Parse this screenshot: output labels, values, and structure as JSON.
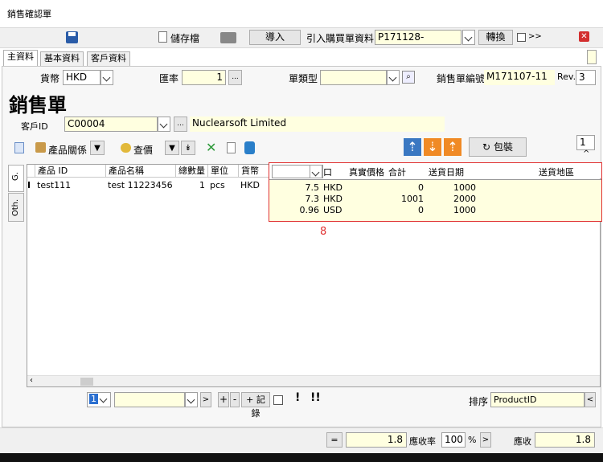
{
  "window": {
    "title": "銷售確認單"
  },
  "toolbar": {
    "save_label": "儲存檔",
    "import_label": "導入",
    "import_purchase_label": "引入購買單資料",
    "purchase_no": "P171128-",
    "convert_label": "轉換",
    "more_label": ">>"
  },
  "tabs": [
    "主資料",
    "基本資料",
    "客戶資料"
  ],
  "header": {
    "currency_label": "貨幣",
    "currency_value": "HKD",
    "rate_label": "匯率",
    "rate_value": "1",
    "ellipsis": "...",
    "doc_type_label": "單類型",
    "doc_type_value": "",
    "sales_no_label": "銷售單編號",
    "sales_no_value": "M171107-11",
    "rev_label": "Rev.",
    "rev_value": "3"
  },
  "form_title": "銷售單",
  "customer": {
    "label": "客戶ID",
    "id": "C00004",
    "name": "Nuclearsoft Limited"
  },
  "actions": {
    "product_relation_label": "產品關係",
    "query_price_label": "查價",
    "pack_label": "包裝",
    "page_value": "1",
    "up_arrow": "^"
  },
  "side_tabs": [
    "G.",
    "Oth."
  ],
  "grid": {
    "columns": [
      "產品 ID",
      "產品名稱",
      "總數量",
      "單位",
      "貨幣"
    ],
    "row": {
      "product_id": "test111",
      "product_name": "test 11223456",
      "qty": "1",
      "unit": "pcs",
      "currency": "HKD"
    }
  },
  "overlay": {
    "columns": [
      "口",
      "真實價格",
      "合計",
      "送貨日期",
      "送貨地區"
    ],
    "rows": [
      {
        "price": "7.5",
        "currency": "HKD",
        "total": "0",
        "date": "1000"
      },
      {
        "price": "7.3",
        "currency": "HKD",
        "total": "1001",
        "date": "2000"
      },
      {
        "price": "0.96",
        "currency": "USD",
        "total": "0",
        "date": "1000"
      }
    ],
    "annotation": "8"
  },
  "pager": {
    "page": "1",
    "next": ">",
    "add": "+",
    "minus": "-",
    "record_label": "+ 記錄",
    "sort_label": "排序",
    "sort_value": "ProductID"
  },
  "footer": {
    "equals_label": "=",
    "sum_value": "1.8",
    "receivable_rate_label": "應收率",
    "rate_value": "100",
    "percent": "%",
    "next": ">",
    "receivable_label": "應收",
    "receivable_value": "1.8"
  },
  "colors": {
    "field_bg": "#ffffe0",
    "annotation_red": "#e03030",
    "close_red": "#d32f2f"
  }
}
